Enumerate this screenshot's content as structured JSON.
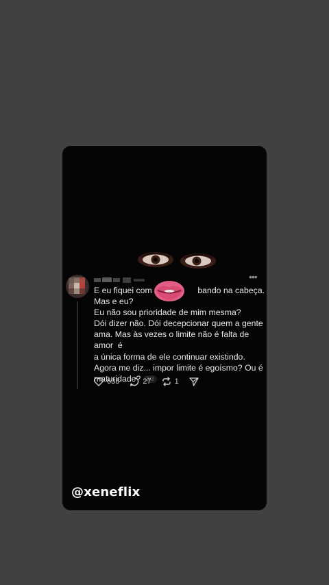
{
  "post": {
    "lines": [
      "E eu fiquei com ess",
      "Mas e eu?",
      "Eu não sou prioridade de mim mesma?",
      "Dói dizer não. Dói decepcionar quem a gente",
      "ama. Mas às vezes o limite não é falta de amor  é",
      "a única forma de ele continuar existindo.",
      "Agora me diz... impor limite é egoísmo? Ou é",
      "maturidade?"
    ],
    "line1_end": "bando na cabeça.",
    "page_indicator": "3/3"
  },
  "actions": {
    "likes": "638",
    "comments": "27",
    "reposts": "1"
  },
  "icons": [
    "more-icon",
    "heart-icon",
    "comment-icon",
    "repost-icon",
    "share-icon"
  ],
  "watermark": "@xeneflix",
  "colors": {
    "background": "#434041",
    "card": "#050505",
    "text": "#e9e9e9"
  }
}
